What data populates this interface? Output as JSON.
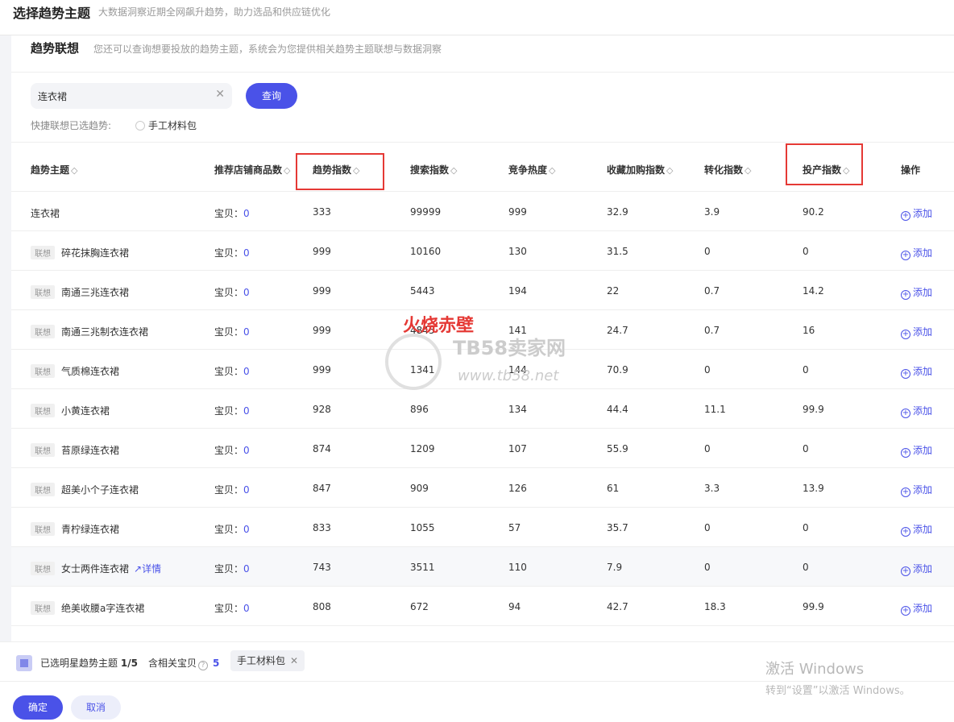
{
  "header": {
    "title": "选择趋势主题",
    "subtitle": "大数据洞察近期全网飙升趋势，助力选品和供应链优化"
  },
  "section": {
    "title": "趋势联想",
    "subtitle": "您还可以查询想要投放的趋势主题，系统会为您提供相关趋势主题联想与数据洞察"
  },
  "search": {
    "value": "连衣裙",
    "button": "查询"
  },
  "quick": {
    "label": "快捷联想已选趋势:",
    "option": "手工材料包"
  },
  "table": {
    "headers": [
      "趋势主题",
      "推荐店铺商品数",
      "趋势指数",
      "搜索指数",
      "竞争热度",
      "收藏加购指数",
      "转化指数",
      "投产指数",
      "操作"
    ],
    "sort_glyph": "◇",
    "assoc_tag": "联想",
    "baby_prefix": "宝贝：",
    "detail_label": "详情",
    "add_label": "添加",
    "rows": [
      {
        "name": "连衣裙",
        "assoc": false,
        "count": "0",
        "trend": "333",
        "search": "99999",
        "compete": "999",
        "fav": "32.9",
        "conv": "3.9",
        "roi": "90.2"
      },
      {
        "name": "碎花抹胸连衣裙",
        "assoc": true,
        "count": "0",
        "trend": "999",
        "search": "10160",
        "compete": "130",
        "fav": "31.5",
        "conv": "0",
        "roi": "0"
      },
      {
        "name": "南通三兆连衣裙",
        "assoc": true,
        "count": "0",
        "trend": "999",
        "search": "5443",
        "compete": "194",
        "fav": "22",
        "conv": "0.7",
        "roi": "14.2"
      },
      {
        "name": "南通三兆制衣连衣裙",
        "assoc": true,
        "count": "0",
        "trend": "999",
        "search": "4845",
        "compete": "141",
        "fav": "24.7",
        "conv": "0.7",
        "roi": "16"
      },
      {
        "name": "气质棉连衣裙",
        "assoc": true,
        "count": "0",
        "trend": "999",
        "search": "1341",
        "compete": "144",
        "fav": "70.9",
        "conv": "0",
        "roi": "0"
      },
      {
        "name": "小黄连衣裙",
        "assoc": true,
        "count": "0",
        "trend": "928",
        "search": "896",
        "compete": "134",
        "fav": "44.4",
        "conv": "11.1",
        "roi": "99.9"
      },
      {
        "name": "苔原绿连衣裙",
        "assoc": true,
        "count": "0",
        "trend": "874",
        "search": "1209",
        "compete": "107",
        "fav": "55.9",
        "conv": "0",
        "roi": "0"
      },
      {
        "name": "超美小个子连衣裙",
        "assoc": true,
        "count": "0",
        "trend": "847",
        "search": "909",
        "compete": "126",
        "fav": "61",
        "conv": "3.3",
        "roi": "13.9"
      },
      {
        "name": "青柠绿连衣裙",
        "assoc": true,
        "count": "0",
        "trend": "833",
        "search": "1055",
        "compete": "57",
        "fav": "35.7",
        "conv": "0",
        "roi": "0"
      },
      {
        "name": "女士两件连衣裙",
        "assoc": true,
        "count": "0",
        "trend": "743",
        "search": "3511",
        "compete": "110",
        "fav": "7.9",
        "conv": "0",
        "roi": "0",
        "detail": true
      },
      {
        "name": "绝美收腰a字连衣裙",
        "assoc": true,
        "count": "0",
        "trend": "808",
        "search": "672",
        "compete": "94",
        "fav": "42.7",
        "conv": "18.3",
        "roi": "99.9"
      }
    ]
  },
  "watermark": {
    "title": "火烧赤壁",
    "brand": "TB58卖家网",
    "url": "www.tb58.net"
  },
  "footer": {
    "selected_label": "已选明星趋势主题",
    "selected_count": "1/5",
    "related_label": "含相关宝贝",
    "related_count": "5",
    "tag": "手工材料包",
    "confirm": "确定",
    "cancel": "取消"
  },
  "windows": {
    "line1": "激活 Windows",
    "line2": "转到“设置”以激活 Windows。"
  },
  "colors": {
    "accent": "#4a52e8",
    "highlight_box": "#e53935"
  }
}
